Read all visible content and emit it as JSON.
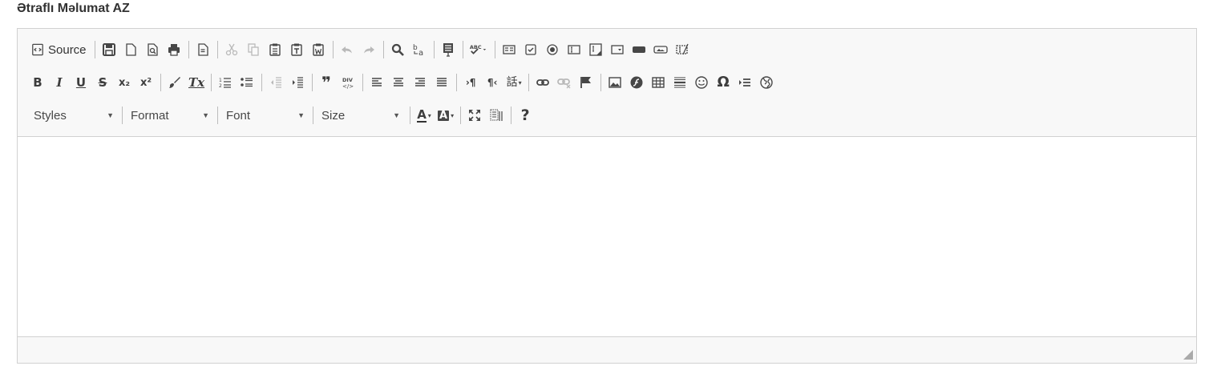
{
  "field": {
    "label": "Ətraflı Məlumat AZ"
  },
  "toolbar": {
    "source_label": "Source",
    "styles_label": "Styles",
    "format_label": "Format",
    "font_label": "Font",
    "size_label": "Size",
    "help_label": "?",
    "icons": {
      "bold": "B",
      "italic": "I",
      "underline": "U",
      "strike": "S",
      "subscript": "x₂",
      "superscript": "x²",
      "remove_format": "Tx",
      "blockquote": "❞",
      "div": "DIV",
      "omega": "Ω",
      "ltr": "›¶",
      "rtl": "¶‹",
      "language": "話",
      "spell": "ABC",
      "text_color": "A",
      "bg_color": "A"
    }
  },
  "colors": {
    "toolbar_bg": "#f8f8f8",
    "border": "#d1d1d1",
    "icon": "#474747"
  }
}
